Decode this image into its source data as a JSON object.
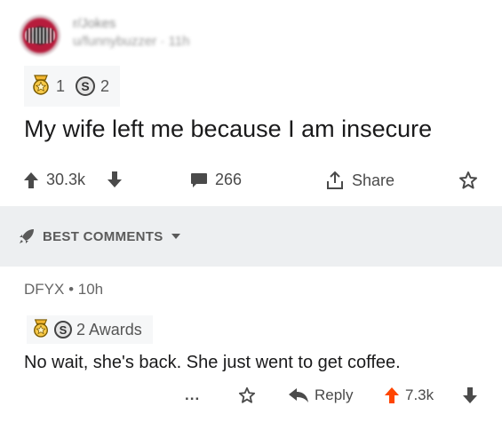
{
  "post": {
    "subreddit": "r/Jokes",
    "meta": "u/funnybuzzer · 11h",
    "awards": [
      {
        "icon": "gold-award-icon",
        "count": "1"
      },
      {
        "icon": "silver-award-icon",
        "count": "2",
        "glyph": "S"
      }
    ],
    "title": "My wife left me because I am insecure",
    "upvotes": "30.3k",
    "comments": "266",
    "share_label": "Share"
  },
  "sort": {
    "label": "BEST COMMENTS"
  },
  "comment": {
    "author": "DFYX",
    "age": "10h",
    "awards_label": "2 Awards",
    "silver_glyph": "S",
    "body": "No wait, she's back. She just went to get coffee.",
    "more_label": "...",
    "reply_label": "Reply",
    "score": "7.3k"
  },
  "colors": {
    "upvote_active": "#ff4500",
    "best_bar_bg": "#edeff1",
    "award_bg": "#f6f7f8"
  }
}
